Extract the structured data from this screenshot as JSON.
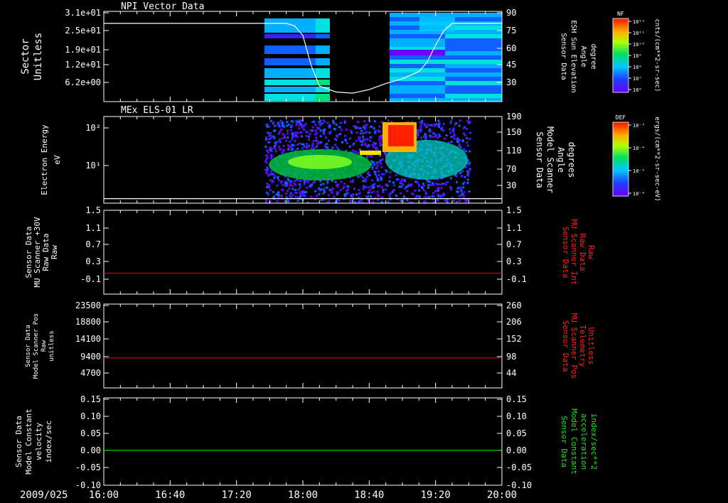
{
  "chart_data": [
    {
      "id": "p1",
      "type": "heatmap",
      "title": "NPI Vector Data",
      "ylabel": [
        "Sector",
        "Unitless"
      ],
      "yticks": [
        "3.1e+01",
        "2.5e+01",
        "1.9e+01",
        "1.2e+01",
        "6.2e+00"
      ],
      "y2label": [
        "Sensor Data",
        "ESH Sun Elevation",
        "Angle",
        "degree"
      ],
      "y2ticks": [
        "90",
        "75",
        "60",
        "45",
        "30"
      ],
      "y2lim": [
        15,
        90
      ],
      "line_series": {
        "x": [
          "16:00",
          "17:50",
          "17:55",
          "18:00",
          "18:05",
          "18:10",
          "18:20",
          "18:30",
          "18:40",
          "18:50",
          "19:00",
          "19:10",
          "19:15",
          "19:20",
          "19:25",
          "19:30",
          "20:00"
        ],
        "y": [
          80,
          80,
          78,
          70,
          45,
          28,
          23,
          22,
          25,
          30,
          34,
          40,
          48,
          62,
          74,
          80,
          80
        ]
      },
      "colorbar": {
        "label": "NF",
        "units": "cnts/(cm**2-sr-sec)",
        "ticks": [
          "10¹²",
          "10¹¹",
          "10¹⁰",
          "10⁹",
          "10⁸",
          "10⁷",
          "10⁶"
        ]
      }
    },
    {
      "id": "p2",
      "type": "heatmap",
      "title": "MEx ELS-01 LR",
      "ylabel": [
        "Electron Energy",
        "eV"
      ],
      "yticks": [
        "10²",
        "10¹"
      ],
      "y2label": [
        "Sensor Data",
        "Model Scanner",
        "Angle",
        "degrees"
      ],
      "y2ticks": [
        "190",
        "150",
        "110",
        "70",
        "30"
      ],
      "y2lim": [
        0,
        190
      ],
      "line_series": {
        "x": [
          "16:00",
          "20:00"
        ],
        "y": [
          10,
          10
        ]
      },
      "colorbar": {
        "label": "DEF",
        "units": "ergs/(cm**2-sr-sec-eV)",
        "ticks": [
          "10⁻³",
          "10⁻⁴",
          "10⁻⁵",
          "10⁻⁶"
        ]
      }
    },
    {
      "id": "p3",
      "type": "line",
      "ylabel": [
        "Sensor Data",
        "MU Scanner +30V",
        "Raw Data",
        "Raw"
      ],
      "yticks": [
        "1.5",
        "1.1",
        "0.7",
        "0.3",
        "-0.1"
      ],
      "ylim": [
        -0.5,
        1.5
      ],
      "y2label": [
        "Sensor Data",
        "MU Scanner Int",
        "Raw Data",
        "Raw"
      ],
      "y2ticks": [
        "1.5",
        "1.1",
        "0.7",
        "0.3",
        "-0.1"
      ],
      "series": [
        {
          "x": [
            "16:00",
            "20:00"
          ],
          "y": [
            0,
            0
          ],
          "color": "#e00000"
        }
      ]
    },
    {
      "id": "p4",
      "type": "line",
      "ylabel": [
        "Sensor Data",
        "Model Scanner Pos",
        "Raw",
        "unitless"
      ],
      "yticks": [
        "23500",
        "18800",
        "14100",
        "9400",
        "4700"
      ],
      "ylim": [
        0,
        23500
      ],
      "y2label": [
        "Sensor Data",
        "MU Scanner Pos",
        "Telemetry",
        "Unitless"
      ],
      "y2ticks": [
        "260",
        "206",
        "152",
        "98",
        "44"
      ],
      "series": [
        {
          "x": [
            "16:00",
            "20:00"
          ],
          "y": [
            8400,
            8400
          ],
          "color": "#e00000"
        }
      ]
    },
    {
      "id": "p5",
      "type": "line",
      "ylabel": [
        "Sensor Data",
        "Model Constant",
        "velocity",
        "index/sec"
      ],
      "yticks": [
        "0.15",
        "0.10",
        "0.05",
        "0.00",
        "-0.05",
        "-0.10"
      ],
      "ylim": [
        -0.1,
        0.15
      ],
      "y2label": [
        "Sensor Data",
        "Model Constant",
        "acceleration",
        "index/sec**2"
      ],
      "y2ticks": [
        "0.15",
        "0.10",
        "0.05",
        "0.00",
        "-0.05",
        "-0.10"
      ],
      "series": [
        {
          "x": [
            "16:00",
            "20:00"
          ],
          "y": [
            0,
            0
          ],
          "color": "#00e000"
        }
      ]
    }
  ],
  "x_axis": {
    "date_label": "2009/025",
    "ticks": [
      "16:00",
      "16:40",
      "17:20",
      "18:00",
      "18:40",
      "19:20",
      "20:00"
    ],
    "xlim": [
      "16:00",
      "20:00"
    ]
  },
  "colors": {
    "left_label_p1_p2": "#ffffff",
    "right_label_p3_p4": "#ff2020",
    "right_label_p5": "#20e020"
  }
}
